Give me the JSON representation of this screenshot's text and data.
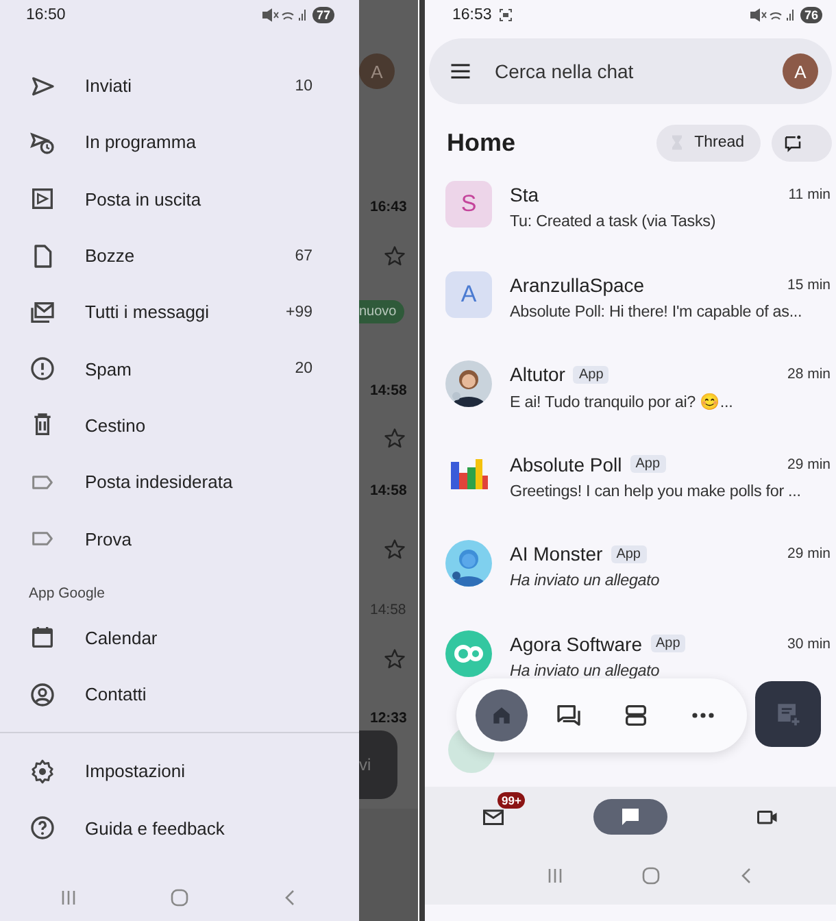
{
  "left_phone": {
    "status_bar": {
      "time": "16:50",
      "battery": "77"
    },
    "drawer": {
      "items": [
        {
          "label": "Inviati",
          "count": "10"
        },
        {
          "label": "In programma"
        },
        {
          "label": "Posta in uscita"
        },
        {
          "label": "Bozze",
          "count": "67"
        },
        {
          "label": "Tutti i messaggi",
          "count": "+99"
        },
        {
          "label": "Spam",
          "count": "20"
        },
        {
          "label": "Cestino"
        },
        {
          "label": "Posta indesiderata"
        },
        {
          "label": "Prova"
        }
      ],
      "section_title": "App Google",
      "app_items": [
        {
          "label": "Calendar"
        },
        {
          "label": "Contatti"
        }
      ],
      "footer_items": [
        {
          "label": "Impostazioni"
        },
        {
          "label": "Guida e feedback"
        }
      ]
    },
    "inbox_behind": {
      "avatar": "A",
      "chip": "nuovo",
      "button": "vi",
      "times": [
        "16:43",
        "14:58",
        "14:58",
        "14:58",
        "12:33"
      ]
    }
  },
  "right_phone": {
    "status_bar": {
      "time": "16:53",
      "battery": "76"
    },
    "search": {
      "placeholder": "Cerca nella chat",
      "avatar": "A"
    },
    "title": "Home",
    "thread_button": "Thread",
    "chats": [
      {
        "name": "Sta",
        "time": "11 min",
        "message": "Tu: Created a task (via Tasks)",
        "italic": false,
        "avatar": {
          "kind": "letter",
          "letter": "S",
          "color": "#c4449b"
        }
      },
      {
        "name": "AranzullaSpace",
        "time": "15 min",
        "message": "Absolute Poll: Hi there! I'm capable of as...",
        "italic": false,
        "avatar": {
          "kind": "letter",
          "letter": "A",
          "color": "#4b7bd1"
        }
      },
      {
        "name": "Altutor",
        "badge": "App",
        "time": "28 min",
        "message": "E ai! Tudo tranquilo por ai? 😊...",
        "italic": false
      },
      {
        "name": "Absolute Poll",
        "badge": "App",
        "time": "29 min",
        "message": "Greetings! I can help you make polls for ...",
        "italic": false,
        "avatar": {
          "kind": "poll_logo"
        }
      },
      {
        "name": "AI Monster",
        "badge": "App",
        "time": "29 min",
        "message": "Ha inviato un allegato",
        "italic": true
      },
      {
        "name": "Agora Software",
        "badge": "App",
        "time": "30 min",
        "message": "Ha inviato un allegato",
        "italic": true,
        "avatar": {
          "kind": "agora_logo"
        }
      }
    ],
    "floating_nav": [
      {
        "selected": true
      },
      {
        "selected": false
      },
      {
        "selected": false
      },
      {
        "selected": false
      }
    ],
    "bottom_tabs": [
      {
        "selected": false,
        "badge": "99+"
      },
      {
        "selected": true
      },
      {
        "selected": false
      }
    ]
  }
}
